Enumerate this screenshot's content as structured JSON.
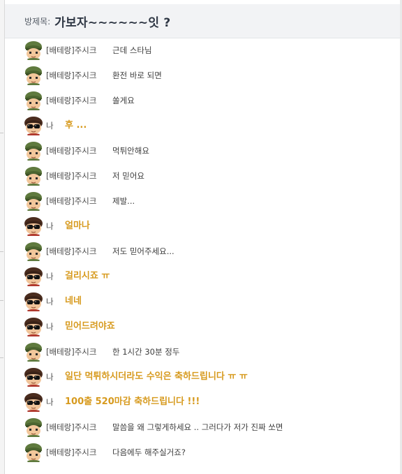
{
  "header": {
    "label": "방제목:",
    "title": "가보자~~~~~~잇 ?"
  },
  "colors": {
    "mine_text": "#d79a1e",
    "other_text": "#3d3d3d",
    "header_bg": "#f2f3f5"
  },
  "messages": [
    {
      "sender": "[배테랑]주시크",
      "text": "근데 스타님",
      "mine": false,
      "avatar": "soldier-avatar-icon"
    },
    {
      "sender": "[배테랑]주시크",
      "text": "환전 바로 되면",
      "mine": false,
      "avatar": "soldier-avatar-icon"
    },
    {
      "sender": "[배테랑]주시크",
      "text": "쏠게요",
      "mine": false,
      "avatar": "soldier-avatar-icon"
    },
    {
      "sender": "나",
      "text": "후 ...",
      "mine": true,
      "avatar": "sunglasses-avatar-icon"
    },
    {
      "sender": "[배테랑]주시크",
      "text": "먹튀안해요",
      "mine": false,
      "avatar": "soldier-avatar-icon"
    },
    {
      "sender": "[배테랑]주시크",
      "text": "저 믿어요",
      "mine": false,
      "avatar": "soldier-avatar-icon"
    },
    {
      "sender": "[배테랑]주시크",
      "text": "제발...",
      "mine": false,
      "avatar": "soldier-avatar-icon"
    },
    {
      "sender": "나",
      "text": "얼마나",
      "mine": true,
      "avatar": "sunglasses-avatar-icon"
    },
    {
      "sender": "[배테랑]주시크",
      "text": "저도 믿어주세요...",
      "mine": false,
      "avatar": "soldier-avatar-icon"
    },
    {
      "sender": "나",
      "text": "걸리시죠 ㅠ",
      "mine": true,
      "avatar": "sunglasses-avatar-icon"
    },
    {
      "sender": "나",
      "text": "네네",
      "mine": true,
      "avatar": "sunglasses-avatar-icon"
    },
    {
      "sender": "나",
      "text": "믿어드려야죠",
      "mine": true,
      "avatar": "sunglasses-avatar-icon"
    },
    {
      "sender": "[배테랑]주시크",
      "text": "한 1시간 30분 정두",
      "mine": false,
      "avatar": "soldier-avatar-icon"
    },
    {
      "sender": "나",
      "text": "일단 먹튀하시더라도 수익은 축하드립니다 ㅠ ㅠ",
      "mine": true,
      "avatar": "sunglasses-avatar-icon"
    },
    {
      "sender": "나",
      "text": "100출 520마감 축하드립니다 !!!",
      "mine": true,
      "avatar": "sunglasses-avatar-icon"
    },
    {
      "sender": "[배테랑]주시크",
      "text": "말씀을 왜 그렇게하세요 .. 그러다가 저가 진짜 쏘면",
      "mine": false,
      "avatar": "soldier-avatar-icon"
    },
    {
      "sender": "[배테랑]주시크",
      "text": "다음에두 해주실거죠?",
      "mine": false,
      "avatar": "soldier-avatar-icon"
    }
  ]
}
